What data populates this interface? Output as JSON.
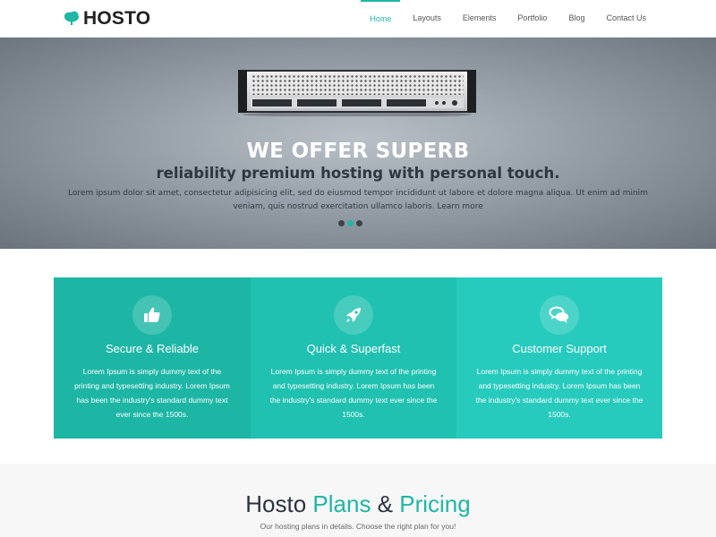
{
  "brand": {
    "name": "HOSTO",
    "accent": "#1fb7a6",
    "logo_icon": "cloud-tree-icon"
  },
  "nav": {
    "items": [
      {
        "label": "Home",
        "active": true
      },
      {
        "label": "Layouts",
        "active": false
      },
      {
        "label": "Elements",
        "active": false
      },
      {
        "label": "Portfolio",
        "active": false
      },
      {
        "label": "Blog",
        "active": false
      },
      {
        "label": "Contact Us",
        "active": false
      }
    ]
  },
  "hero": {
    "title": "WE OFFER SUPERB",
    "subtitle": "reliability premium hosting with personal touch.",
    "text": "Lorem ipsum dolor sit amet, consectetur adipisicing elit, sed do eiusmod tempor incididunt ut labore et dolore magna aliqua. Ut enim ad minim veniam, quis nostrud exercitation ullamco laboris. Learn more",
    "slides": {
      "count": 3,
      "active_index": 1
    }
  },
  "features": [
    {
      "icon": "thumbs-up-icon",
      "title": "Secure & Reliable",
      "text": "Lorem Ipsum is simply dummy text of the printing and typesetting industry. Lorem Ipsum has been the industry's standard dummy text ever since the 1500s."
    },
    {
      "icon": "rocket-icon",
      "title": "Quick & Superfast",
      "text": "Lorem Ipsum is simply dummy text of the printing and typesetting industry. Lorem Ipsum has been the industry's standard dummy text ever since the 1500s."
    },
    {
      "icon": "chat-bubbles-icon",
      "title": "Customer Support",
      "text": "Lorem Ipsum is simply dummy text of the printing and typesetting industry. Lorem Ipsum has been the industry's standard dummy text ever since the 1500s."
    }
  ],
  "pricing": {
    "title_part1": "Hosto ",
    "title_part2": "Plans",
    "title_part3": " & ",
    "title_part4": "Pricing",
    "subtitle": "Our hosting plans in details. Choose the right plan for you!"
  }
}
